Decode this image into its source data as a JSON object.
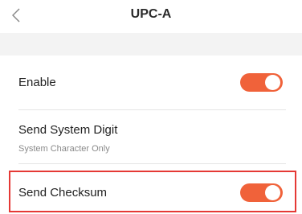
{
  "header": {
    "title": "UPC-A",
    "back_icon": "chevron-left-icon"
  },
  "settings": [
    {
      "label": "Enable",
      "toggle": true
    },
    {
      "label": "Send System Digit",
      "sublabel": "System Character Only"
    },
    {
      "label": "Send Checksum",
      "toggle": true
    }
  ],
  "colors": {
    "accent": "#f0623a",
    "highlight": "#e53935",
    "band": "#f3f3f3"
  }
}
